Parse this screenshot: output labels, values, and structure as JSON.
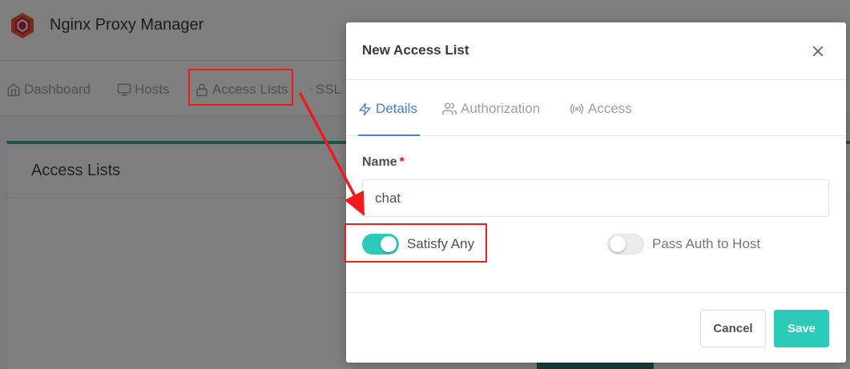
{
  "app": {
    "title": "Nginx Proxy Manager",
    "nav": [
      {
        "label": "Dashboard",
        "icon": "home-icon"
      },
      {
        "label": "Hosts",
        "icon": "monitor-icon"
      },
      {
        "label": "Access Lists",
        "icon": "lock-icon"
      },
      {
        "label": "SSL",
        "icon": "shield-icon"
      }
    ],
    "card_title": "Access Lists"
  },
  "modal": {
    "title": "New Access List",
    "tabs": [
      {
        "label": "Details",
        "icon": "zap-icon",
        "active": true
      },
      {
        "label": "Authorization",
        "icon": "users-icon",
        "active": false
      },
      {
        "label": "Access",
        "icon": "radio-icon",
        "active": false
      }
    ],
    "name_label": "Name",
    "required_marker": "*",
    "name_value": "chat",
    "toggles": [
      {
        "label": "Satisfy Any",
        "checked": true
      },
      {
        "label": "Pass Auth to Host",
        "checked": false
      }
    ],
    "cancel_label": "Cancel",
    "save_label": "Save"
  },
  "colors": {
    "accent_blue": "#467fcf",
    "teal": "#2bcbba",
    "annotation_red": "#ef1c1c"
  }
}
